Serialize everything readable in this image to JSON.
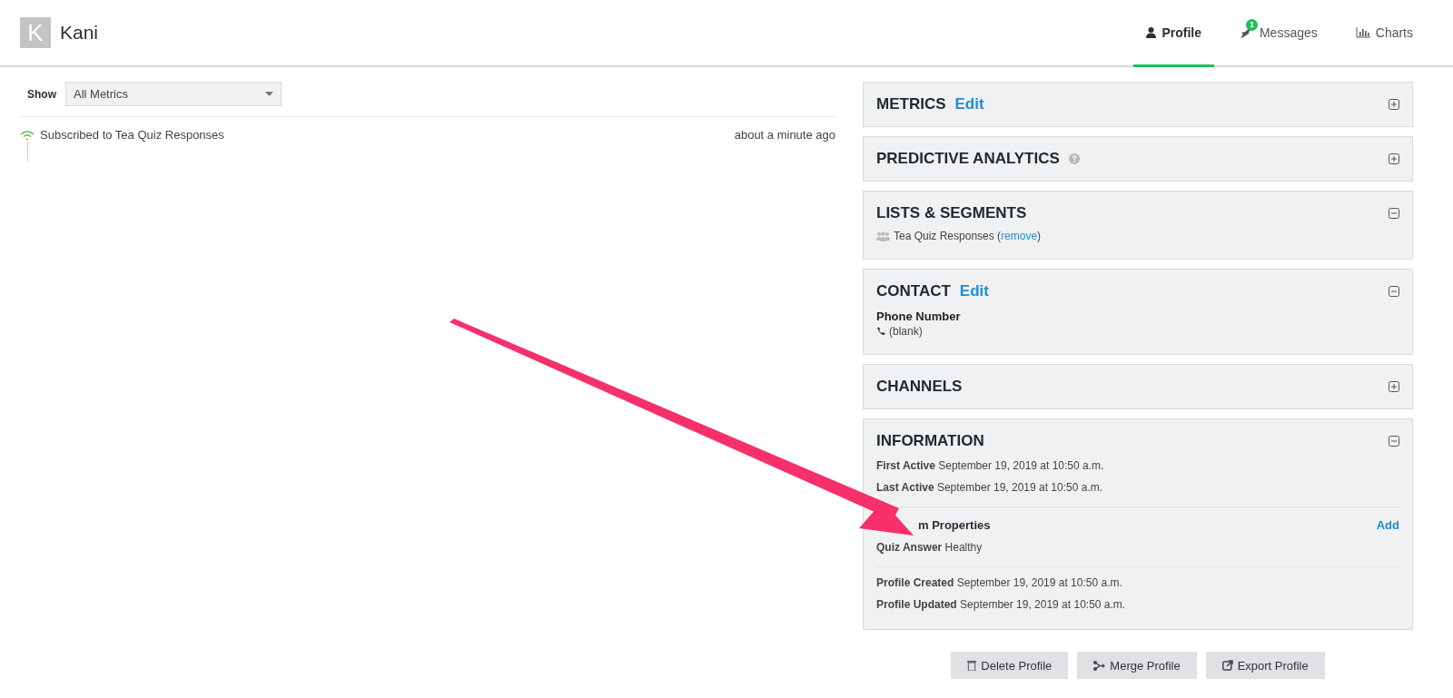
{
  "header": {
    "avatar_letter": "K",
    "name": "Kani"
  },
  "tabs": [
    {
      "label": "Profile",
      "kind": "profile",
      "selected": true
    },
    {
      "label": "Messages",
      "kind": "messages",
      "badge": "1",
      "selected": false
    },
    {
      "label": "Charts",
      "kind": "charts",
      "selected": false
    }
  ],
  "filter": {
    "label": "Show",
    "value": "All Metrics"
  },
  "activity": [
    {
      "text": "Subscribed to Tea Quiz Responses",
      "time": "about a minute ago"
    }
  ],
  "sections": [
    {
      "title": "METRICS",
      "edit": "Edit",
      "expanded": false
    },
    {
      "title": "PREDICTIVE ANALYTICS",
      "help": true,
      "expanded": false
    },
    {
      "title": "LISTS & SEGMENTS",
      "expanded": true,
      "items": [
        {
          "name": "Tea Quiz Responses",
          "open": "(",
          "action": "remove",
          "close": ")"
        }
      ]
    },
    {
      "title": "CONTACT",
      "edit": "Edit",
      "expanded": true,
      "field_label": "Phone Number",
      "field_value": "(blank)"
    },
    {
      "title": "CHANNELS",
      "expanded": false
    },
    {
      "title": "INFORMATION",
      "expanded": true,
      "activity": [
        {
          "label": "First Active",
          "value": "September 19, 2019 at 10:50 a.m."
        },
        {
          "label": "Last Active",
          "value": "September 19, 2019 at 10:50 a.m."
        }
      ],
      "custom_title": "m Properties",
      "custom_action": "Add",
      "custom": [
        {
          "label": "Quiz Answer",
          "value": "Healthy"
        }
      ],
      "profile": [
        {
          "label": "Profile Created",
          "value": "September 19, 2019 at 10:50 a.m."
        },
        {
          "label": "Profile Updated",
          "value": "September 19, 2019 at 10:50 a.m."
        }
      ]
    }
  ],
  "buttons": [
    {
      "kind": "delete",
      "label": "Delete Profile"
    },
    {
      "kind": "merge",
      "label": "Merge Profile"
    },
    {
      "kind": "export",
      "label": "Export Profile"
    }
  ]
}
